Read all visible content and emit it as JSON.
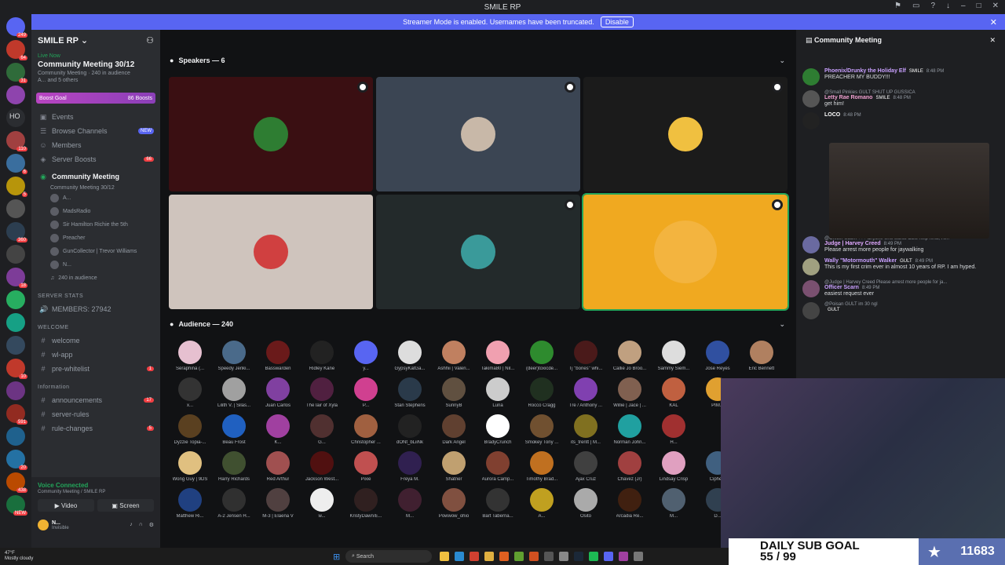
{
  "titlebar": {
    "title": "SMILE RP"
  },
  "banner": {
    "text": "Streamer Mode is enabled. Usernames have been truncated.",
    "button": "Disable"
  },
  "server_rail": [
    {
      "badge": "249",
      "color": "#5865f2"
    },
    {
      "badge": "64",
      "color": "#c0392b"
    },
    {
      "badge": "31",
      "color": "#2f6b3a"
    },
    {
      "badge": "",
      "color": "#8e44ad"
    },
    {
      "badge": "",
      "label": "HO",
      "color": "#2b2d31"
    },
    {
      "badge": "110",
      "color": "#a04040"
    },
    {
      "badge": "6",
      "color": "#3a6e9e"
    },
    {
      "badge": "5",
      "color": "#b7950b"
    },
    {
      "badge": "",
      "color": "#555"
    },
    {
      "badge": "360",
      "color": "#2c3e50"
    },
    {
      "badge": "",
      "color": "#444"
    },
    {
      "badge": "18",
      "color": "#7d3c98"
    },
    {
      "badge": "",
      "color": "#27ae60"
    },
    {
      "badge": "",
      "color": "#16a085"
    },
    {
      "badge": "",
      "color": "#34495e"
    },
    {
      "badge": "10",
      "color": "#c0392b"
    },
    {
      "badge": "",
      "color": "#6c3483"
    },
    {
      "badge": "591",
      "color": "#922b21"
    },
    {
      "badge": "",
      "color": "#1f618d"
    },
    {
      "badge": "20",
      "color": "#2471a3"
    },
    {
      "badge": "438",
      "color": "#ba4a00"
    },
    {
      "badge": "NEW",
      "color": "#196f3d"
    }
  ],
  "sidebar": {
    "server_name": "SMILE RP",
    "live": {
      "tag": "Live Now",
      "title": "Community Meeting 30/12",
      "sub": "Community Meeting · 240 in audience",
      "sub2": "A... and 5 others"
    },
    "boost": {
      "label": "Boost Goal",
      "count": "86 Boosts"
    },
    "channels": [
      {
        "icon": "▣",
        "name": "Events"
      },
      {
        "icon": "☰",
        "name": "Browse Channels",
        "new": "NEW"
      },
      {
        "icon": "☺",
        "name": "Members"
      },
      {
        "icon": "◈",
        "name": "Server Boosts",
        "count": "66"
      }
    ],
    "stage": {
      "name": "Community Meeting",
      "topic": "Community Meeting 30/12"
    },
    "voice_members": [
      "A...",
      "MadsRadio",
      "Sir Hamilton Richie the 5th",
      "Preacher",
      "GunCollector | Trevor Williams",
      "N..."
    ],
    "audience": "240 in audience",
    "categories": [
      {
        "title": "SERVER STATS",
        "items": [
          {
            "icon": "🔊",
            "name": "MEMBERS: 27942"
          }
        ]
      },
      {
        "title": "WELCOME",
        "items": [
          {
            "icon": "#",
            "name": "welcome"
          },
          {
            "icon": "#",
            "name": "wl-app"
          },
          {
            "icon": "#",
            "name": "pre-whitelist",
            "count": "1"
          }
        ]
      },
      {
        "title": "Information",
        "items": [
          {
            "icon": "#",
            "name": "announcements",
            "count": "17"
          },
          {
            "icon": "#",
            "name": "server-rules"
          },
          {
            "icon": "#",
            "name": "rule-changes",
            "count": "5"
          }
        ]
      }
    ]
  },
  "voice_panel": {
    "status": "Voice Connected",
    "sub": "Community Meeting / SMILE RP",
    "video": "Video",
    "screen": "Screen"
  },
  "user_panel": {
    "name": "N...",
    "status": "Invisible"
  },
  "main": {
    "speakers_label": "Speakers — 6",
    "audience_label": "Audience — 240",
    "tiles": [
      {
        "bg": "#3a0f12",
        "av": "#2e7d32"
      },
      {
        "bg": "#3b4553",
        "av": "#c8b8a8"
      },
      {
        "bg": "#1b1b1b",
        "av": "#f0c040"
      },
      {
        "bg": "#cfc4bd",
        "av": "#d04040"
      },
      {
        "bg": "#232a2b",
        "av": "#3a9a9a"
      },
      {
        "bg": "#f0a920",
        "av": "#f6c266"
      }
    ],
    "audience": [
      {
        "name": "Seraphina (...",
        "color": "#e6c0d0"
      },
      {
        "name": "Speedy Jenki...",
        "color": "#4a6a8a"
      },
      {
        "name": "Basswarden",
        "color": "#6a1a1a"
      },
      {
        "name": "Ridley Kane",
        "color": "#222"
      },
      {
        "name": "y...",
        "color": "#5865f2"
      },
      {
        "name": "GypsyKatGa...",
        "color": "#ddd"
      },
      {
        "name": "Ashhii | Valeri...",
        "color": "#c08060"
      },
      {
        "name": "Takima80 | Nil...",
        "color": "#f0a0b0"
      },
      {
        "name": "(deer)toxicde...",
        "color": "#2e8b2e"
      },
      {
        "name": "Tj \"bones\" whi...",
        "color": "#4a1a1a"
      },
      {
        "name": "Callie Jo Broo...",
        "color": "#c0a080"
      },
      {
        "name": "Sammy Siem...",
        "color": "#ddd"
      },
      {
        "name": "Jose Reyes",
        "color": "#3050a0"
      },
      {
        "name": "Eric Bennett",
        "color": "#b08060"
      },
      {
        "name": "x...",
        "color": "#333"
      },
      {
        "name": "Lilith V. | Silas...",
        "color": "#a0a0a0"
      },
      {
        "name": "Juan Carlos",
        "color": "#8040a0"
      },
      {
        "name": "The lair of Xyla",
        "color": "#502040"
      },
      {
        "name": "P...",
        "color": "#d04090"
      },
      {
        "name": "Stan Stephens",
        "color": "#2a3a4a"
      },
      {
        "name": "SunnyB",
        "color": "#605040"
      },
      {
        "name": "Luna",
        "color": "#ccc"
      },
      {
        "name": "Rocco Cragg",
        "color": "#203020"
      },
      {
        "name": "Tre / Anthony ...",
        "color": "#8040b0"
      },
      {
        "name": "Willie | Jace | ...",
        "color": "#806050"
      },
      {
        "name": "KAL",
        "color": "#c06040"
      },
      {
        "name": "PIM...",
        "color": "#e0a030"
      },
      {
        "name": "",
        "color": "#111214"
      },
      {
        "name": "Dyzzie Topia-...",
        "color": "#5a4020"
      },
      {
        "name": "Beau Frost",
        "color": "#2060c0"
      },
      {
        "name": "K...",
        "color": "#a040a0"
      },
      {
        "name": "G...",
        "color": "#503030"
      },
      {
        "name": "Christopher ...",
        "color": "#a06040"
      },
      {
        "name": "dONt_bLiiNk",
        "color": "#222"
      },
      {
        "name": "Dark Angel",
        "color": "#604030"
      },
      {
        "name": "BradyCrunch",
        "color": "#fff"
      },
      {
        "name": "Smokey Tony ...",
        "color": "#705030"
      },
      {
        "name": "its_trentt | M...",
        "color": "#807020"
      },
      {
        "name": "Norman John...",
        "color": "#20a0a0"
      },
      {
        "name": "H...",
        "color": "#a03030"
      },
      {
        "name": "",
        "color": "#111214"
      },
      {
        "name": "",
        "color": "#111214"
      },
      {
        "name": "Wong Guy | 9DS",
        "color": "#e0c080"
      },
      {
        "name": "Harry Richards",
        "color": "#405030"
      },
      {
        "name": "Red Arthur",
        "color": "#a05050"
      },
      {
        "name": "Jackson West...",
        "color": "#501010"
      },
      {
        "name": "Pixie",
        "color": "#c05050"
      },
      {
        "name": "Freya M.",
        "color": "#302050"
      },
      {
        "name": "Shatner",
        "color": "#c0a070"
      },
      {
        "name": "Aurora Camp...",
        "color": "#804030"
      },
      {
        "name": "Timothy Brad...",
        "color": "#c07020"
      },
      {
        "name": "Ajax Cruz",
        "color": "#404040"
      },
      {
        "name": "Chavez (Jr)",
        "color": "#a04040"
      },
      {
        "name": "Lindsay Crisp",
        "color": "#e0a0c0"
      },
      {
        "name": "Ciphe...",
        "color": "#406080"
      },
      {
        "name": "",
        "color": "#111214"
      },
      {
        "name": "Matthew Ri...",
        "color": "#204080"
      },
      {
        "name": "A-2 Jensen H...",
        "color": "#303030"
      },
      {
        "name": "M-3 | Elaena V",
        "color": "#504040"
      },
      {
        "name": "w...",
        "color": "#eee"
      },
      {
        "name": "KristyDawn/E...",
        "color": "#302020"
      },
      {
        "name": "M...",
        "color": "#402030"
      },
      {
        "name": "Powwow_ohio",
        "color": "#805040"
      },
      {
        "name": "Bart Taberna...",
        "color": "#333"
      },
      {
        "name": "A...",
        "color": "#c0a020"
      },
      {
        "name": "Osito",
        "color": "#aaa"
      },
      {
        "name": "Arcadia Re...",
        "color": "#402010"
      },
      {
        "name": "M...",
        "color": "#506070"
      },
      {
        "name": "D...",
        "color": "#304050"
      },
      {
        "name": "",
        "color": "#111214"
      }
    ]
  },
  "chat": {
    "title": "Community Meeting",
    "messages": [
      {
        "name": "Phoenix/Drunky the Holiday Elf",
        "name_color": "#c9a0ff",
        "tag": "SMILE",
        "time": "8:48 PM",
        "text": "PREACHER MY BUDDY!!!",
        "av": "#2e7d32"
      },
      {
        "reply": "@Small Pinkies GULT SHUT UP GUSSICA",
        "name": "Letty Rae Romano",
        "name_color": "#f0a0d0",
        "tag": "SMILE",
        "time": "8:48 PM",
        "text": "get him!",
        "av": "#555"
      },
      {
        "name": "LOCO",
        "name_color": "#ffffff",
        "tag": "",
        "time": "8:48 PM",
        "text": "",
        "av": "#222"
      },
      {
        "reply": "@Officer Scarn +++ anyone who wants OBS help hmu, I'll...",
        "name": "Judge | Harvey Creed",
        "name_color": "#e0a8ff",
        "tag": "",
        "time": "8:49 PM",
        "text": "Please arrest more people for jaywalking",
        "av": "#6a6aa0"
      },
      {
        "name": "Wally \"Motormouth\" Walker",
        "name_color": "#c9a0ff",
        "tag": "GULT",
        "time": "8:49 PM",
        "text": "This is my first crim ever in almost 10 years of RP. I am hyped.",
        "av": "#a0a080"
      },
      {
        "reply": "@Judge | Harvey Creed Please arrest more people for ja...",
        "name": "Officer Scarn",
        "name_color": "#c9a0ff",
        "tag": "",
        "time": "8:49 PM",
        "text": "easiest request ever",
        "av": "#7a5070"
      },
      {
        "reply": "@Poisan GULT im 30 ngl",
        "name": "",
        "name_color": "#ffffff",
        "tag": "GULT",
        "time": "",
        "text": "",
        "av": "#444"
      }
    ]
  },
  "overlay": {
    "goal_label": "DAILY SUB GOAL",
    "goal_value": "55 / 99",
    "count": "11683"
  },
  "taskbar": {
    "temp": "47°F",
    "weather": "Mostly cloudy",
    "search": "Search"
  }
}
